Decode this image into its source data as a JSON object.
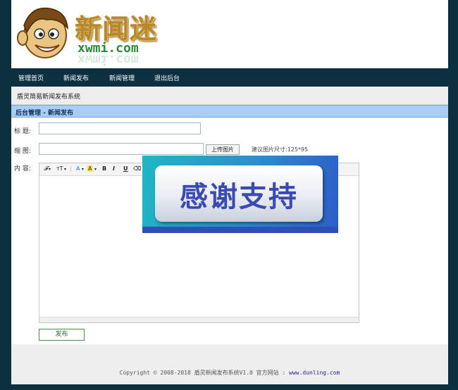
{
  "header": {
    "logo_cn": "新闻迷",
    "logo_en": "xwmi.com"
  },
  "nav": {
    "items": [
      {
        "label": "管理首页"
      },
      {
        "label": "新闻发布"
      },
      {
        "label": "新闻管理"
      },
      {
        "label": "退出后台"
      }
    ]
  },
  "system_title": "盾灵简易新闻发布系统",
  "breadcrumb": "后台管理 - 新闻发布",
  "form": {
    "title_label": "标 题:",
    "title_value": "",
    "thumb_label": "缩 图:",
    "thumb_value": "",
    "upload_label": "上传图片",
    "size_hint": "建议图片尺寸:125*95",
    "content_label": "内 容:",
    "publish_label": "发布"
  },
  "editor": {
    "toolbar": {
      "font_family": "𝓕",
      "font_size": "тT",
      "font_color": "A",
      "bg_color": "A",
      "bold": "B",
      "italic": "I",
      "underline": "U"
    }
  },
  "overlay": {
    "text": "感谢支持"
  },
  "footer": {
    "copyright": "Copyright © 2008-2018 盾灵新闻发布系统V1.0 官方网站 : ",
    "site": "www.dunling.com"
  },
  "colors": {
    "background": "#0c3040",
    "breadcrumb_bar": "#a9cdf5",
    "publish_border": "#4e8a4e",
    "overlay_text": "#3a4ab0"
  }
}
